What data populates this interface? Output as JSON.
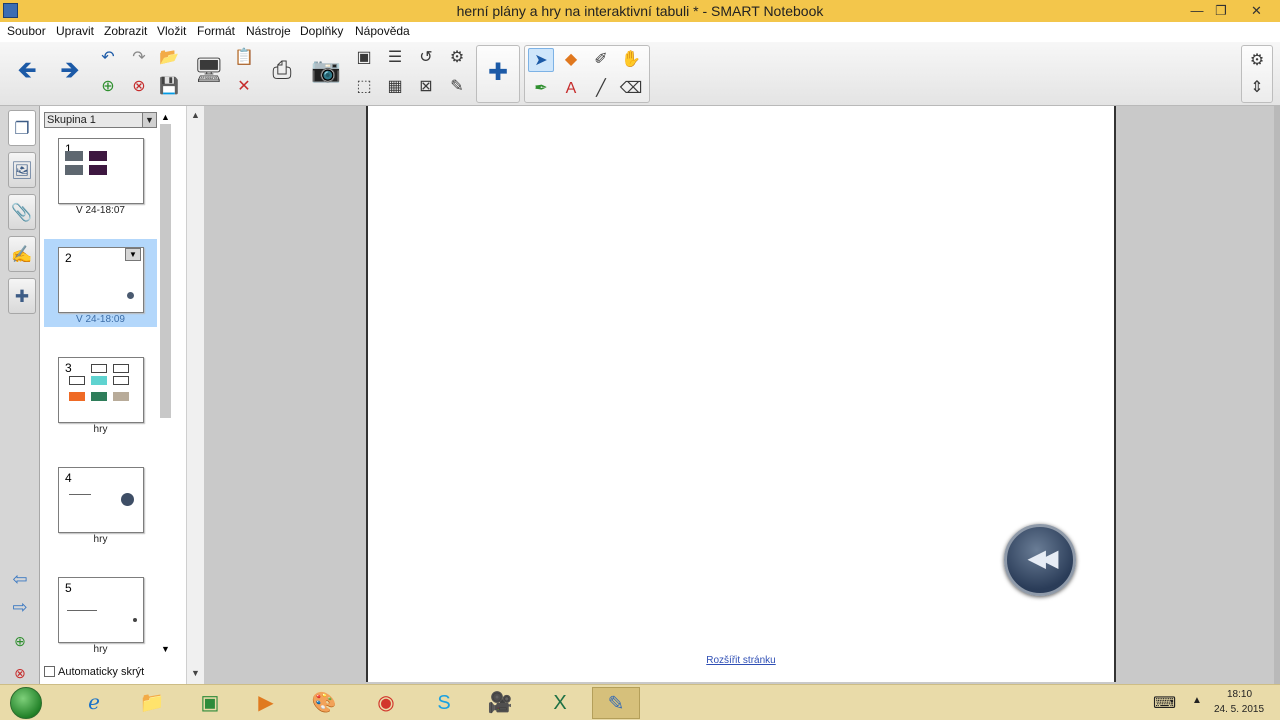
{
  "window": {
    "title": "herní plány a hry na interaktivní tabuli * - SMART Notebook",
    "minimize_glyph": "—",
    "maximize_glyph": "❐",
    "close_glyph": "✕"
  },
  "menu": {
    "items": [
      "Soubor",
      "Upravit",
      "Zobrazit",
      "Vložit",
      "Formát",
      "Nástroje",
      "Doplňky",
      "Nápověda"
    ]
  },
  "toolbar": {
    "back_icon": "arrow-left-icon",
    "forward_icon": "arrow-right-icon",
    "selected_tool": "select-arrow"
  },
  "sorter": {
    "group_label": "Skupina 1",
    "pages": [
      {
        "number": "1",
        "label": "V 24-18:07"
      },
      {
        "number": "2",
        "label": "V 24-18:09"
      },
      {
        "number": "3",
        "label": "hry"
      },
      {
        "number": "4",
        "label": "hry"
      },
      {
        "number": "5",
        "label": "hry"
      }
    ],
    "selected_page": 2,
    "autohide_label": "Automaticky skrýt",
    "autohide_checked": false
  },
  "workspace": {
    "extend_link": "Rozšířit stránku"
  },
  "taskbar": {
    "time": "18:10",
    "date": "24. 5. 2015",
    "apps": [
      "internet-explorer",
      "file-explorer",
      "store",
      "media-player",
      "paint",
      "chrome",
      "skype",
      "video-app",
      "excel",
      "smart-notebook"
    ],
    "active_app": "smart-notebook"
  },
  "colors": {
    "title_bar": "#f3c64b",
    "taskbar": "#e9dba9",
    "selection": "#b3d7fb",
    "link": "#2f4fb5"
  }
}
